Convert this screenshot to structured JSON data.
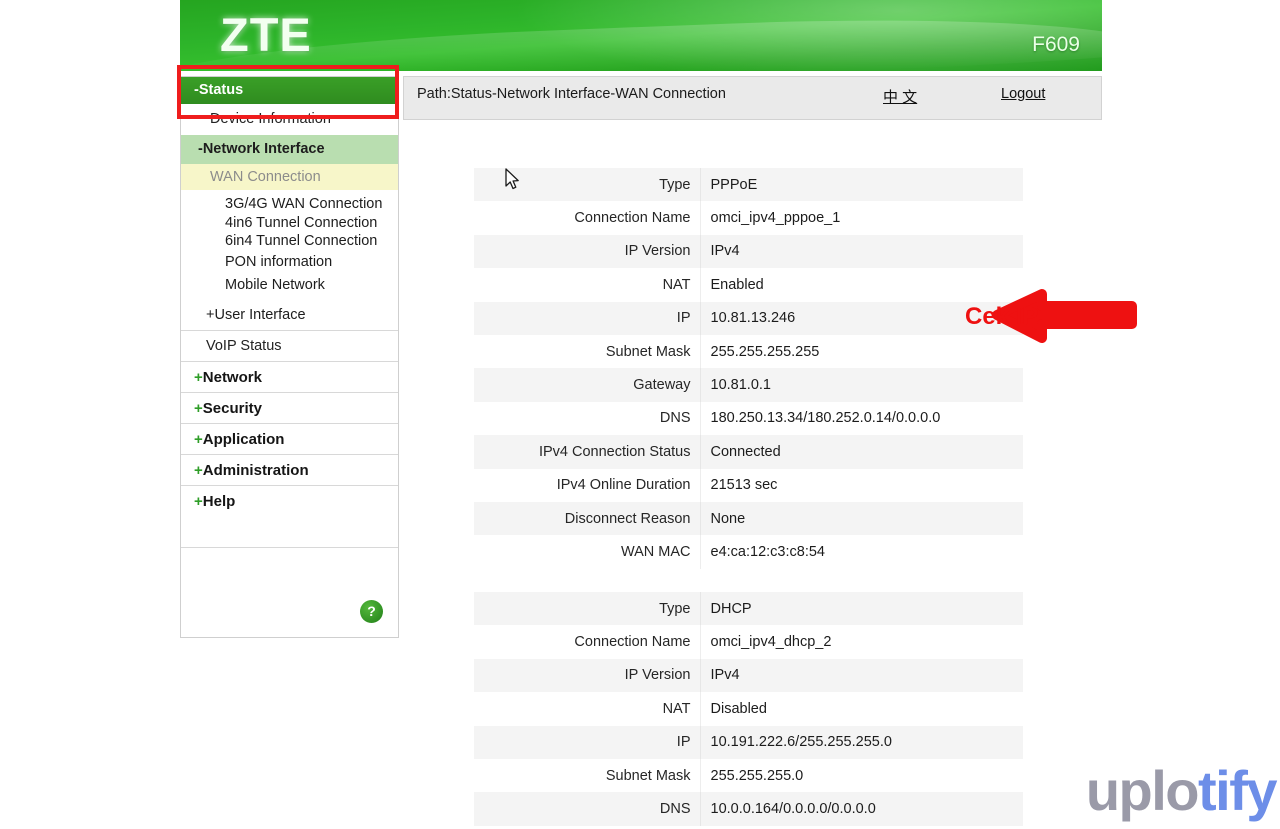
{
  "header": {
    "logo": "ZTE",
    "model": "F609"
  },
  "pathbar": {
    "path": "Path:Status-Network Interface-WAN Connection",
    "language_link": "中 文",
    "logout_link": "Logout"
  },
  "sidebar": {
    "status_label": "-Status",
    "device_information": "Device Information",
    "network_interface": "-Network Interface",
    "wan_connection": "WAN Connection",
    "leaf_items": [
      "3G/4G WAN Connection",
      "4in6 Tunnel Connection",
      "6in4 Tunnel Connection",
      "PON information",
      "Mobile Network"
    ],
    "user_interface": "+User Interface",
    "voip_status": "VoIP Status",
    "major_items": [
      {
        "plus": "+",
        "label": "Network"
      },
      {
        "plus": "+",
        "label": "Security"
      },
      {
        "plus": "+",
        "label": "Application"
      },
      {
        "plus": "+",
        "label": "Administration"
      },
      {
        "plus": "+",
        "label": "Help"
      }
    ],
    "help_badge": "?"
  },
  "tables": {
    "pppoe": [
      {
        "key": "Type",
        "value": "PPPoE"
      },
      {
        "key": "Connection Name",
        "value": "omci_ipv4_pppoe_1"
      },
      {
        "key": "IP Version",
        "value": "IPv4"
      },
      {
        "key": "NAT",
        "value": "Enabled"
      },
      {
        "key": "IP",
        "value": "10.81.13.246"
      },
      {
        "key": "Subnet Mask",
        "value": "255.255.255.255"
      },
      {
        "key": "Gateway",
        "value": "10.81.0.1"
      },
      {
        "key": "DNS",
        "value": "180.250.13.34/180.252.0.14/0.0.0.0"
      },
      {
        "key": "IPv4 Connection Status",
        "value": "Connected"
      },
      {
        "key": "IPv4 Online Duration",
        "value": "21513 sec"
      },
      {
        "key": "Disconnect Reason",
        "value": "None"
      },
      {
        "key": "WAN MAC",
        "value": "e4:ca:12:c3:c8:54"
      }
    ],
    "dhcp": [
      {
        "key": "Type",
        "value": "DHCP"
      },
      {
        "key": "Connection Name",
        "value": "omci_ipv4_dhcp_2"
      },
      {
        "key": "IP Version",
        "value": "IPv4"
      },
      {
        "key": "NAT",
        "value": "Disabled"
      },
      {
        "key": "IP",
        "value": "10.191.222.6/255.255.255.0"
      },
      {
        "key": "Subnet Mask",
        "value": "255.255.255.0"
      },
      {
        "key": "DNS",
        "value": "10.0.0.164/0.0.0.0/0.0.0.0"
      }
    ]
  },
  "annotation": {
    "label": "Cek IP",
    "color": "#ee1111"
  },
  "watermark": {
    "part_a": "uplo",
    "part_b": "tify",
    "color_a": "#9a9aa8",
    "color_b": "#6d8ee8"
  }
}
